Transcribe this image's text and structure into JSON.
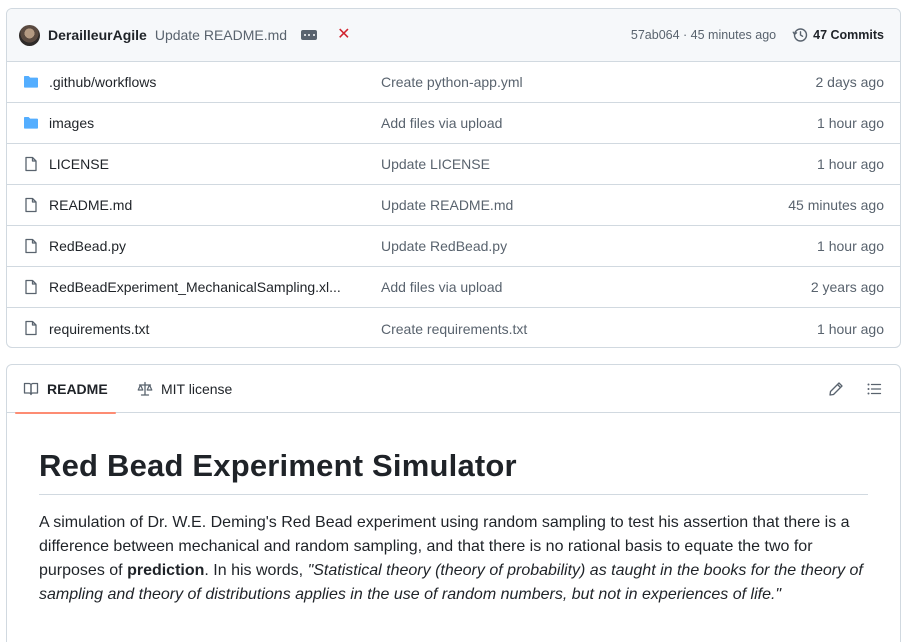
{
  "commit": {
    "author": "DerailleurAgile",
    "message": "Update README.md",
    "meta": "57ab064 · 45 minutes ago",
    "commits_label": "47 Commits",
    "status": "failed",
    "colors": {
      "fail": "#d1242f"
    }
  },
  "files": [
    {
      "type": "folder",
      "name": ".github/workflows",
      "message": "Create python-app.yml",
      "age": "2 days ago"
    },
    {
      "type": "folder",
      "name": "images",
      "message": "Add files via upload",
      "age": "1 hour ago"
    },
    {
      "type": "file",
      "name": "LICENSE",
      "message": "Update LICENSE",
      "age": "1 hour ago"
    },
    {
      "type": "file",
      "name": "README.md",
      "message": "Update README.md",
      "age": "45 minutes ago"
    },
    {
      "type": "file",
      "name": "RedBead.py",
      "message": "Update RedBead.py",
      "age": "1 hour ago"
    },
    {
      "type": "file",
      "name": "RedBeadExperiment_MechanicalSampling.xl...",
      "message": "Add files via upload",
      "age": "2 years ago"
    },
    {
      "type": "file",
      "name": "requirements.txt",
      "message": "Create requirements.txt",
      "age": "1 hour ago"
    }
  ],
  "readme": {
    "tabs": {
      "readme": "README",
      "license": "MIT license"
    },
    "title": "Red Bead Experiment Simulator",
    "para": {
      "part1": "A simulation of Dr. W.E. Deming's Red Bead experiment using random sampling to test his assertion that there is a difference between mechanical and random sampling, and that there is no rational basis to equate the two for purposes of ",
      "bold": "prediction",
      "part2": ". In his words, ",
      "quote": "\"Statistical theory (theory of probability) as taught in the books for the theory of sampling and theory of distributions applies in the use of random numbers, but not in experiences of life.\""
    },
    "accent_color": "#fd8c73"
  },
  "icons": {
    "folder": "folder-icon",
    "file": "file-icon",
    "history": "history-icon",
    "book": "book-icon",
    "law": "law-icon",
    "pencil": "pencil-icon",
    "outline": "list-icon"
  }
}
